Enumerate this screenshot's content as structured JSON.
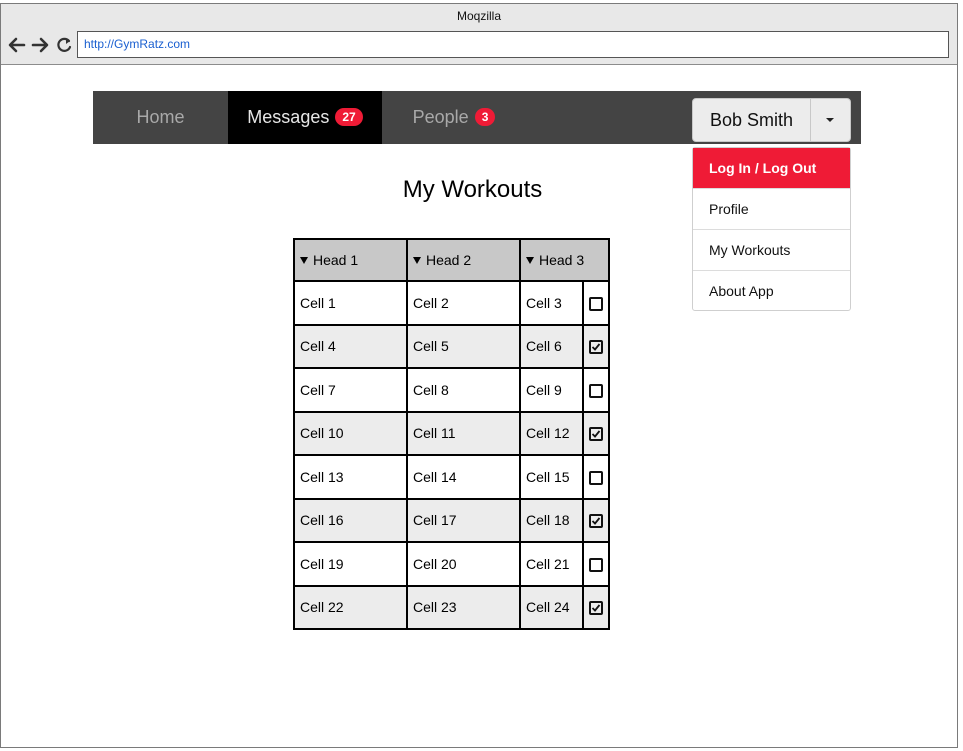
{
  "window": {
    "title": "Moqzilla"
  },
  "browser": {
    "url": "http://GymRatz.com"
  },
  "nav": {
    "home": "Home",
    "messages": "Messages",
    "messages_count": "27",
    "people": "People",
    "people_count": "3"
  },
  "user": {
    "name": "Bob Smith"
  },
  "menu": {
    "items": [
      "Log In / Log Out",
      "Profile",
      "My Workouts",
      "About App"
    ]
  },
  "page": {
    "title": "My Workouts"
  },
  "table": {
    "headers": [
      "Head 1",
      "Head 2",
      "Head 3"
    ],
    "rows": [
      [
        "Cell 1",
        "Cell 2",
        "Cell 3"
      ],
      [
        "Cell 4",
        "Cell 5",
        "Cell 6"
      ],
      [
        "Cell 7",
        "Cell 8",
        "Cell 9"
      ],
      [
        "Cell 10",
        "Cell 11",
        "Cell 12"
      ],
      [
        "Cell 13",
        "Cell 14",
        "Cell 15"
      ],
      [
        "Cell 16",
        "Cell 17",
        "Cell 18"
      ],
      [
        "Cell 19",
        "Cell 20",
        "Cell 21"
      ],
      [
        "Cell 22",
        "Cell 23",
        "Cell 24"
      ]
    ],
    "checked": [
      false,
      true,
      false,
      true,
      false,
      true,
      false,
      true
    ]
  },
  "colors": {
    "accent": "#ef1b36",
    "navbar": "#444444",
    "active_tab": "#000000"
  }
}
